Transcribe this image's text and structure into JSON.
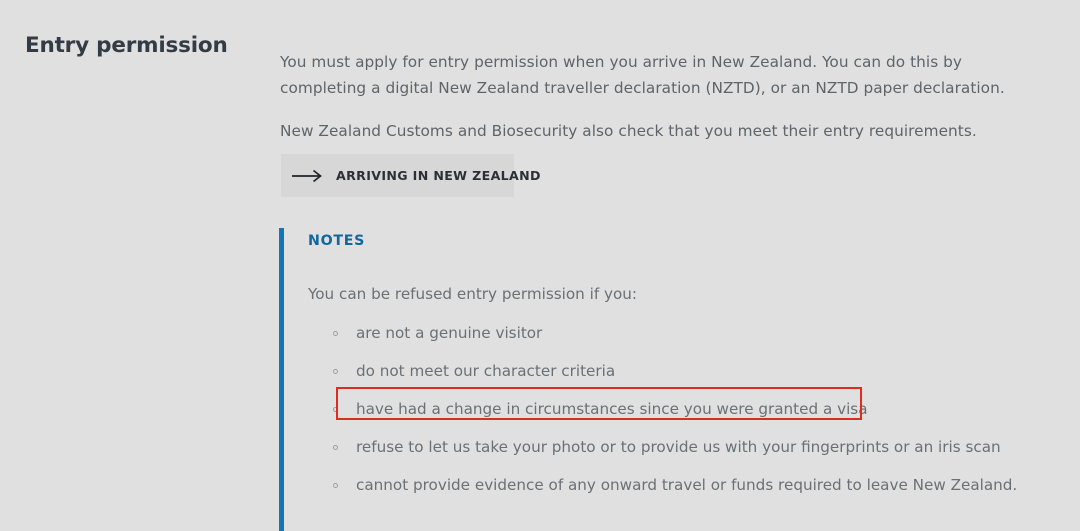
{
  "page": {
    "background_color": "#e0e0e0",
    "title": "Entry permission"
  },
  "intro": {
    "paragraph_1": "You must apply for entry permission when you arrive in New Zealand. You can do this by completing a digital New Zealand traveller declaration (NZTD), or an NZTD paper declaration.",
    "paragraph_2": "New Zealand Customs and Biosecurity also check that you meet their entry requirements."
  },
  "action_button": {
    "label": "ARRIVING IN NEW ZEALAND",
    "icon": "long-arrow-right-icon",
    "background_color": "#d7d7d7"
  },
  "notes": {
    "heading": "NOTES",
    "accent_color": "#1277b4",
    "intro": "You can be refused entry permission if you:",
    "items": [
      {
        "text": "are not a genuine visitor",
        "highlighted": false
      },
      {
        "text": "do not meet our character criteria",
        "highlighted": false
      },
      {
        "text": "have had a change in circumstances since you were granted a visa",
        "highlighted": true
      },
      {
        "text": "refuse to let us take your photo or to provide us with your fingerprints or an iris scan",
        "highlighted": false
      },
      {
        "text": "cannot provide evidence of any onward travel or funds required to leave New Zealand.",
        "highlighted": false
      }
    ],
    "highlight_color": "#dd2c20"
  }
}
